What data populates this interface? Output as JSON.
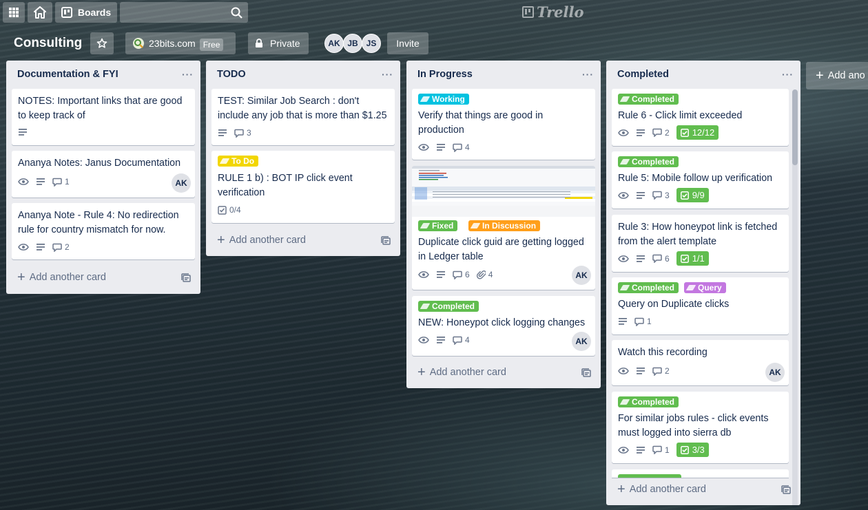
{
  "topbar": {
    "boards_label": "Boards",
    "logo_text": "Trello"
  },
  "board": {
    "title": "Consulting",
    "workspace_name": "23bits.com",
    "workspace_plan": "Free",
    "visibility_label": "Private",
    "members": [
      "AK",
      "JB",
      "JS"
    ],
    "invite_label": "Invite",
    "add_list_label": "Add ano"
  },
  "lists": [
    {
      "title": "Documentation & FYI",
      "menu": "···",
      "add_card": "Add another card",
      "cards": [
        {
          "title": "NOTES: Important links that are good to keep track of",
          "badges": {
            "description": true
          }
        },
        {
          "title": "Ananya Notes: Janus Documentation",
          "badges": {
            "watching": true,
            "description": true,
            "comments": "1"
          },
          "member": "AK"
        },
        {
          "title": "Ananya Note - Rule 4: No redirection rule for country mismatch for now.",
          "badges": {
            "watching": true,
            "description": true,
            "comments": "2"
          }
        }
      ]
    },
    {
      "title": "TODO",
      "menu": "···",
      "add_card": "Add another card",
      "cards": [
        {
          "title": "TEST: Similar Job Search : don't include any job that is more than $1.25",
          "badges": {
            "description": true,
            "comments": "3"
          }
        },
        {
          "labels": [
            "To Do"
          ],
          "title": "RULE 1 b) : BOT IP click event verification",
          "badges": {
            "checklist": "0/4"
          }
        }
      ]
    },
    {
      "title": "In Progress",
      "menu": "···",
      "add_card": "Add another card",
      "cards": [
        {
          "labels": [
            "Working"
          ],
          "title": "Verify that things are good in production",
          "badges": {
            "watching": true,
            "description": true,
            "comments": "4"
          }
        },
        {
          "labels": [
            "Fixed",
            "In Discussion"
          ],
          "title": "Duplicate click guid are getting logged in Ledger table",
          "badges": {
            "watching": true,
            "description": true,
            "comments": "6",
            "attachments": "4"
          },
          "member": "AK"
        },
        {
          "labels": [
            "Completed"
          ],
          "title": "NEW: Honeypot click logging changes",
          "badges": {
            "watching": true,
            "description": true,
            "comments": "4"
          },
          "member": "AK"
        }
      ]
    },
    {
      "title": "Completed",
      "menu": "···",
      "add_card": "Add another card",
      "cards": [
        {
          "labels": [
            "Completed"
          ],
          "title": "Rule 6 - Click limit exceeded",
          "badges": {
            "watching": true,
            "description": true,
            "comments": "2",
            "checklist": "12/12"
          }
        },
        {
          "labels": [
            "Completed"
          ],
          "title": "Rule 5: Mobile follow up verification",
          "badges": {
            "watching": true,
            "description": true,
            "comments": "3",
            "checklist": "9/9"
          }
        },
        {
          "title": "Rule 3: How honeypot link is fetched from the alert template",
          "badges": {
            "watching": true,
            "description": true,
            "comments": "6",
            "checklist": "1/1"
          }
        },
        {
          "labels": [
            "Completed",
            "Query"
          ],
          "title": "Query on Duplicate clicks",
          "badges": {
            "description": true,
            "comments": "1"
          }
        },
        {
          "title": "Watch this recording",
          "badges": {
            "watching": true,
            "description": true,
            "comments": "2"
          },
          "member": "AK"
        },
        {
          "labels": [
            "Completed"
          ],
          "title": "For similar jobs rules - click events must logged into sierra db",
          "badges": {
            "watching": true,
            "description": true,
            "comments": "1",
            "checklist": "3/3"
          }
        }
      ]
    }
  ],
  "colors": {
    "label_green": "#61bd4f",
    "label_blue": "#00c2e0",
    "label_yellow": "#f2d600",
    "label_orange": "#ff9f1a",
    "label_purple": "#c377e0"
  }
}
